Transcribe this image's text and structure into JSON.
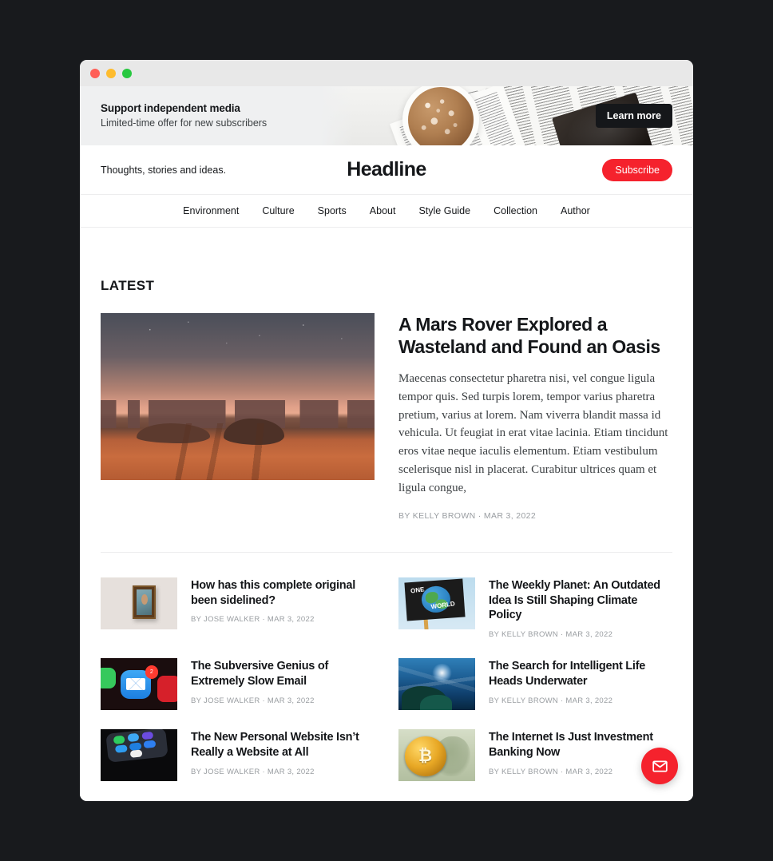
{
  "promo": {
    "title": "Support independent media",
    "subtitle": "Limited-time offer for new subscribers",
    "cta_label": "Learn more",
    "background_color": "#eff0f1",
    "cta_color": "#15171a"
  },
  "header": {
    "tagline": "Thoughts, stories and ideas.",
    "brand": "Headline",
    "subscribe_label": "Subscribe",
    "accent_color": "#f5222d"
  },
  "nav": {
    "items": [
      {
        "label": "Environment"
      },
      {
        "label": "Culture"
      },
      {
        "label": "Sports"
      },
      {
        "label": "About"
      },
      {
        "label": "Style Guide"
      },
      {
        "label": "Collection"
      },
      {
        "label": "Author"
      }
    ]
  },
  "main": {
    "section_title": "LATEST",
    "featured": {
      "title": "A Mars Rover Explored a Wasteland and Found an Oasis",
      "excerpt": "Maecenas consectetur pharetra nisi, vel congue ligula tempor quis. Sed turpis lorem, tempor varius pharetra pretium, varius at lorem. Nam viverra blandit massa id vehicula. Ut feugiat in erat vitae lacinia. Etiam tincidunt eros vitae neque iaculis elementum. Etiam vestibulum scelerisque nisl in placerat. Curabitur ultrices quam et ligula congue,",
      "author": "BY KELLY BROWN",
      "separator": "·",
      "date": "MAR 3, 2022",
      "byline": "BY KELLY BROWN · MAR 3, 2022",
      "image": "mars-desert-at-dusk"
    },
    "posts": [
      {
        "title": "How has this complete original been sidelined?",
        "byline": "BY JOSE WALKER · MAR 3, 2022",
        "author": "BY JOSE WALKER",
        "date": "MAR 3, 2022",
        "image": "framed-portrait-painting"
      },
      {
        "title": "The Weekly Planet: An Outdated Idea Is Still Shaping Climate Policy",
        "byline": "BY KELLY BROWN · MAR 3, 2022",
        "author": "BY KELLY BROWN",
        "date": "MAR 3, 2022",
        "image": "one-world-protest-sign",
        "sign_word_one": "ONE",
        "sign_word_two": "WORLD"
      },
      {
        "title": "The Subversive Genius of Extremely Slow Email",
        "byline": "BY JOSE WALKER · MAR 3, 2022",
        "author": "BY JOSE WALKER",
        "date": "MAR 3, 2022",
        "image": "mail-app-icon-with-badge",
        "badge_count": "2"
      },
      {
        "title": "The Search for Intelligent Life Heads Underwater",
        "byline": "BY KELLY BROWN · MAR 3, 2022",
        "author": "BY KELLY BROWN",
        "date": "MAR 3, 2022",
        "image": "underwater-sunlight-coral"
      },
      {
        "title": "The New Personal Website Isn’t Really a Website at All",
        "byline": "BY JOSE WALKER · MAR 3, 2022",
        "author": "BY JOSE WALKER",
        "date": "MAR 3, 2022",
        "image": "phone-home-screen-apps"
      },
      {
        "title": "The Internet Is Just Investment Banking Now",
        "byline": "BY KELLY BROWN · MAR 3, 2022",
        "author": "BY KELLY BROWN",
        "date": "MAR 3, 2022",
        "image": "bitcoin-coin-on-dollar-bill",
        "coin_symbol": "₿"
      }
    ]
  },
  "portal": {
    "icon": "envelope-icon",
    "color": "#f5222d"
  }
}
